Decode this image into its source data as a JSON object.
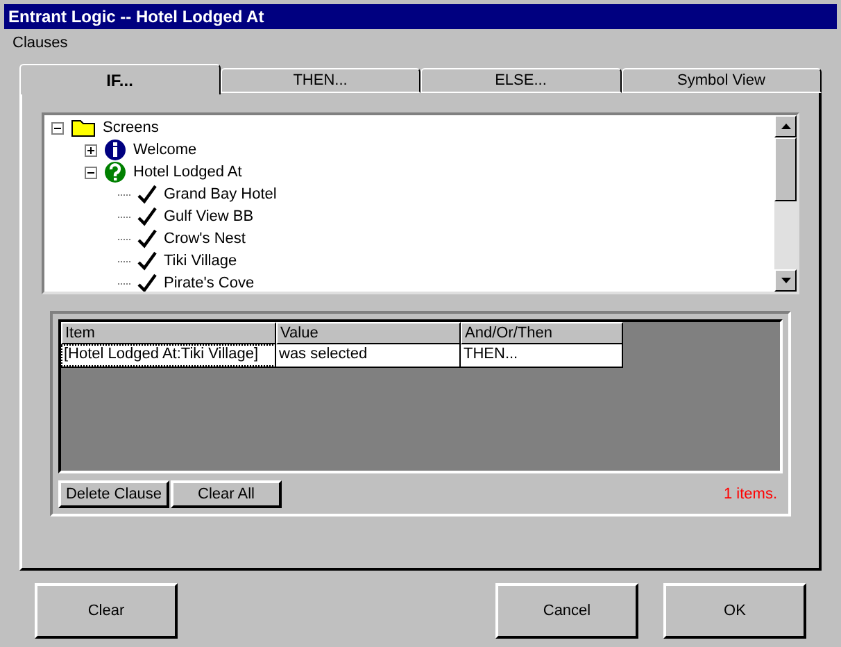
{
  "window": {
    "title": "Entrant Logic -- Hotel Lodged At"
  },
  "menu": [
    "Clauses"
  ],
  "tabs": [
    {
      "label": "IF...",
      "selected": true
    },
    {
      "label": "THEN...",
      "selected": false
    },
    {
      "label": "ELSE...",
      "selected": false
    },
    {
      "label": "Symbol View",
      "selected": false
    }
  ],
  "tree": [
    {
      "label": "Screens",
      "kind": "folder",
      "expanded": true,
      "children": [
        {
          "label": "Welcome",
          "kind": "info",
          "expanded": false
        },
        {
          "label": "Hotel Lodged At",
          "kind": "question",
          "expanded": true,
          "children": [
            {
              "label": "Grand Bay Hotel",
              "kind": "check"
            },
            {
              "label": "Gulf View BB",
              "kind": "check"
            },
            {
              "label": "Crow's Nest",
              "kind": "check"
            },
            {
              "label": "Tiki Village",
              "kind": "check"
            },
            {
              "label": "Pirate's Cove",
              "kind": "check"
            }
          ]
        }
      ]
    }
  ],
  "table": {
    "columns": [
      "Item",
      "Value",
      "And/Or/Then"
    ],
    "rows": [
      {
        "cells": [
          "[Hotel Lodged At:Tiki Village]",
          "was selected",
          "THEN..."
        ],
        "selected": true
      }
    ]
  },
  "table_buttons": [
    "Delete Clause",
    "Clear All"
  ],
  "item_count": "1 items.",
  "buttons": [
    "Clear",
    "Cancel",
    "OK"
  ]
}
